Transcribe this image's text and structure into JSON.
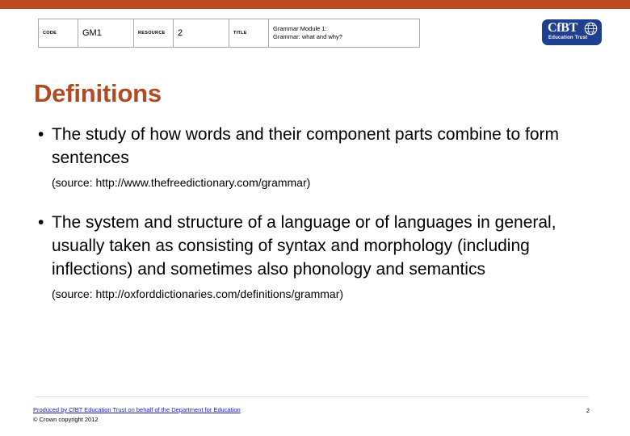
{
  "theme": {
    "accent_bar_color": "#bd4a1c",
    "title_color": "#b04a22",
    "logo_color": "#1f3f8f",
    "link_color": "#1a1ac8",
    "rule_color": "#e6ddd2"
  },
  "header": {
    "meta_table": {
      "columns": [
        {
          "label": "CODE",
          "value": "GM1"
        },
        {
          "label": "RESOURCE",
          "value": "2"
        }
      ],
      "title_label": "TITLE",
      "title_line_1": "Grammar Module 1:",
      "title_line_2": "Grammar: what and why?"
    },
    "logo": {
      "name": "CfBT",
      "tagline": "Education Trust",
      "icon": "globe-icon"
    }
  },
  "slide": {
    "title": "Definitions",
    "bullets": [
      {
        "marker": "•",
        "text": "The study of how words and their component parts combine to form sentences",
        "source": "(source: http://www.thefreedictionary.com/grammar)"
      },
      {
        "marker": "•",
        "text": "The system and structure of a language or of languages in general, usually taken as consisting of syntax and morphology (including inflections) and sometimes also phonology and semantics",
        "source": "(source: http://oxforddictionaries.com/definitions/grammar)"
      }
    ]
  },
  "footer": {
    "link_text": "Produced by CfBT Education Trust on behalf of the Department for Education",
    "copyright": "© Crown copyright 2012",
    "page_number": "2"
  }
}
